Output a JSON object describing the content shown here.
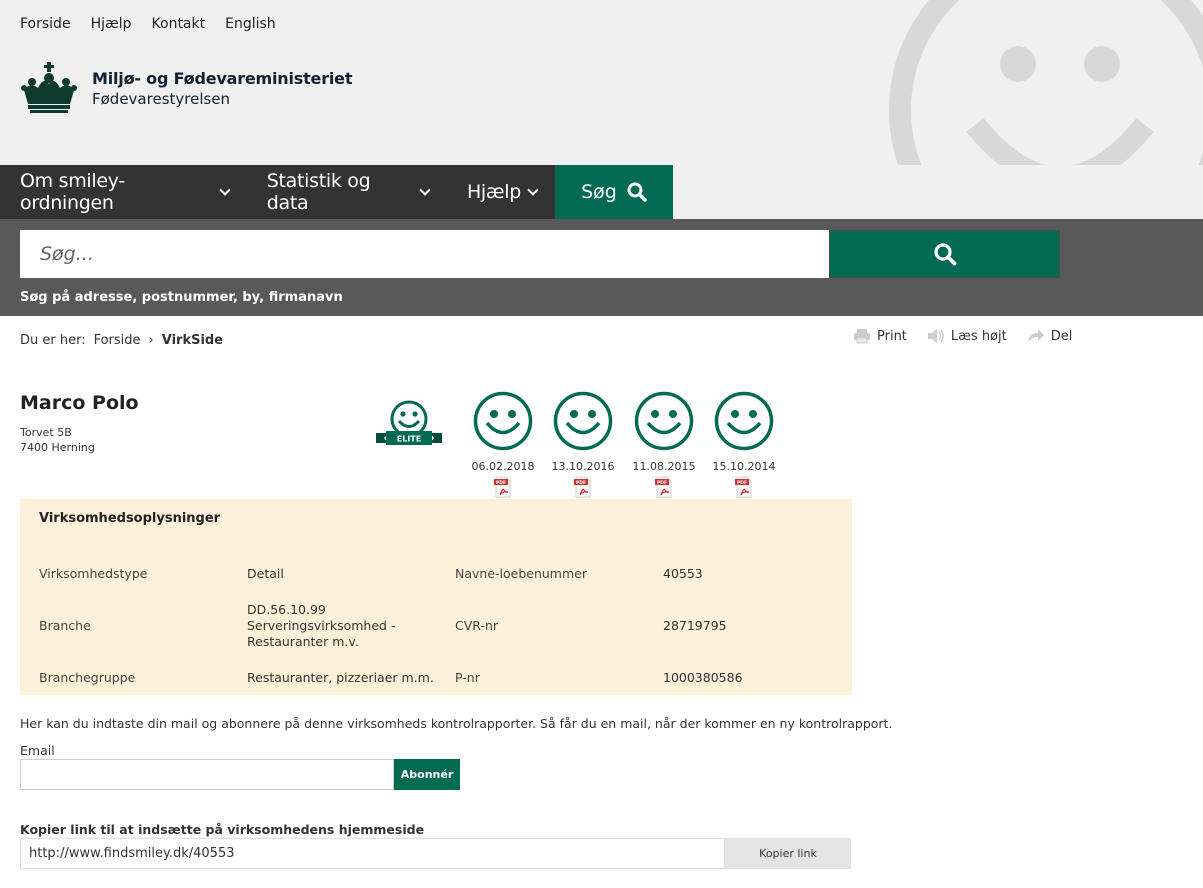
{
  "header": {
    "top_links": [
      "Forside",
      "Hjælp",
      "Kontakt",
      "English"
    ],
    "logo_line1": "Miljø- og Fødevareministeriet",
    "logo_line2": "Fødevarestyrelsen"
  },
  "nav": {
    "items": [
      "Om smiley-ordningen",
      "Statistik og data",
      "Hjælp"
    ],
    "search_label": "Søg"
  },
  "search": {
    "placeholder": "Søg...",
    "hint": "Søg på adresse, postnummer, by, firmanavn"
  },
  "breadcrumb": {
    "prefix": "Du er her:",
    "home": "Forside",
    "current": "VirkSide"
  },
  "tools": [
    "Print",
    "Læs højt",
    "Del"
  ],
  "company": {
    "name": "Marco Polo",
    "address1": "Torvet 5B",
    "address2": "7400 Herning"
  },
  "elite_label": "ELITE",
  "smileys": [
    {
      "date": "06.02.2018"
    },
    {
      "date": "13.10.2016"
    },
    {
      "date": "11.08.2015"
    },
    {
      "date": "15.10.2014"
    }
  ],
  "info": {
    "title": "Virksomhedsoplysninger",
    "rows": [
      {
        "label1": "Virksomhedstype",
        "value1": "Detail",
        "label2": "Navne-loebenummer",
        "value2": "40553"
      },
      {
        "label1": "Branche",
        "value1": "DD.56.10.99 Serveringsvirksomhed - Restauranter m.v.",
        "label2": "CVR-nr",
        "value2": "28719795"
      },
      {
        "label1": "Branchegruppe",
        "value1": "Restauranter, pizzeriaer m.m.",
        "label2": "P-nr",
        "value2": "1000380586"
      }
    ]
  },
  "subscribe": {
    "text": "Her kan du indtaste din mail og abonnere på denne virksomheds kontrolrapporter. Så får du en mail, når der kommer en ny kontrolrapport.",
    "email_label": "Email",
    "email_value": "",
    "button": "Abonnér"
  },
  "copy_link": {
    "label": "Kopier link til at indsætte på virksomhedens hjemmeside",
    "value": "http://www.findsmiley.dk/40553",
    "button": "Kopier link"
  },
  "colors": {
    "brand_green": "#006b52",
    "nav_dark": "#333333",
    "info_bg": "#fdf0d9"
  }
}
